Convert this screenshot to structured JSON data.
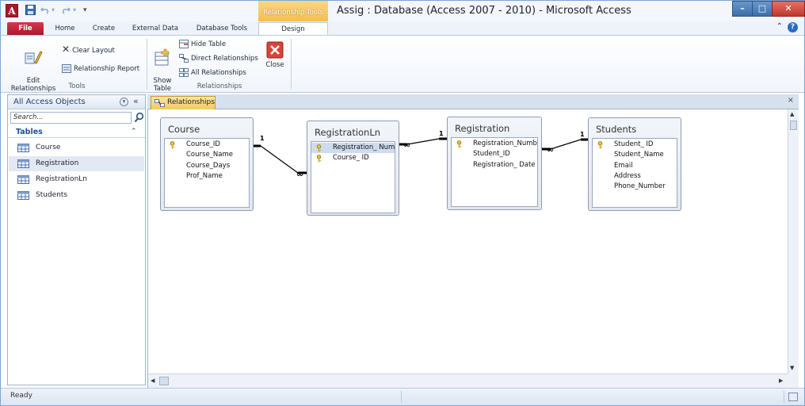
{
  "window": {
    "title": "Assig : Database (Access 2007 - 2010)  -  Microsoft Access",
    "app_icon_letter": "A",
    "minimize_glyph": "–",
    "maximize_glyph": "□",
    "close_glyph": "✕"
  },
  "ribbon": {
    "contextual_tab_label": "Relationship Tools",
    "tabs": [
      {
        "label": "File"
      },
      {
        "label": "Home"
      },
      {
        "label": "Create"
      },
      {
        "label": "External Data"
      },
      {
        "label": "Database Tools"
      },
      {
        "label": "Design"
      }
    ],
    "active_tab": "Design",
    "groups": {
      "tools": {
        "label": "Tools",
        "edit_relationships": "Edit\nRelationships",
        "clear_layout": "Clear Layout",
        "relationship_report": "Relationship Report"
      },
      "relationships": {
        "label": "Relationships",
        "show_table": "Show\nTable",
        "hide_table": "Hide Table",
        "direct_relationships": "Direct Relationships",
        "all_relationships": "All Relationships",
        "close": "Close"
      }
    },
    "help_glyph": "?"
  },
  "nav_pane": {
    "title": "All Access Objects",
    "search_placeholder": "Search...",
    "section_label": "Tables",
    "items": [
      {
        "label": "Course",
        "selected": false
      },
      {
        "label": "Registration",
        "selected": true
      },
      {
        "label": "RegistrationLn",
        "selected": false
      },
      {
        "label": "Students",
        "selected": false
      }
    ]
  },
  "document": {
    "tab_label": "Relationships",
    "close_glyph": "×",
    "tables": [
      {
        "name": "Course",
        "fields": [
          {
            "name": "Course_ID",
            "key": true
          },
          {
            "name": "Course_Name",
            "key": false
          },
          {
            "name": "Course_Days",
            "key": false
          },
          {
            "name": "Prof_Name",
            "key": false
          }
        ]
      },
      {
        "name": "RegistrationLn",
        "fields": [
          {
            "name": "Registration_ Numb",
            "key": true,
            "selected": true
          },
          {
            "name": "Course_ ID",
            "key": true
          }
        ]
      },
      {
        "name": "Registration",
        "fields": [
          {
            "name": "Registration_Numb",
            "key": true
          },
          {
            "name": "Student_ID",
            "key": false
          },
          {
            "name": "Registration_ Date",
            "key": false
          }
        ]
      },
      {
        "name": "Students",
        "fields": [
          {
            "name": "Student_ ID",
            "key": true
          },
          {
            "name": "Student_Name",
            "key": false
          },
          {
            "name": "Email",
            "key": false
          },
          {
            "name": "Address",
            "key": false
          },
          {
            "name": "Phone_Number",
            "key": false
          }
        ]
      }
    ],
    "relationships": [
      {
        "one": "Course",
        "many": "RegistrationLn",
        "one_label": "1",
        "many_label": "∞"
      },
      {
        "one": "Registration",
        "many": "RegistrationLn",
        "one_label": "1",
        "many_label": "∞"
      },
      {
        "one": "Students",
        "many": "Registration",
        "one_label": "1",
        "many_label": "∞"
      }
    ]
  },
  "status_bar": {
    "text": "Ready"
  },
  "colors": {
    "file_tab": "#a8182b",
    "contextual_tab": "#f4c04a",
    "window_frame": "#7aa6d6",
    "relationship_line": "#000000"
  }
}
